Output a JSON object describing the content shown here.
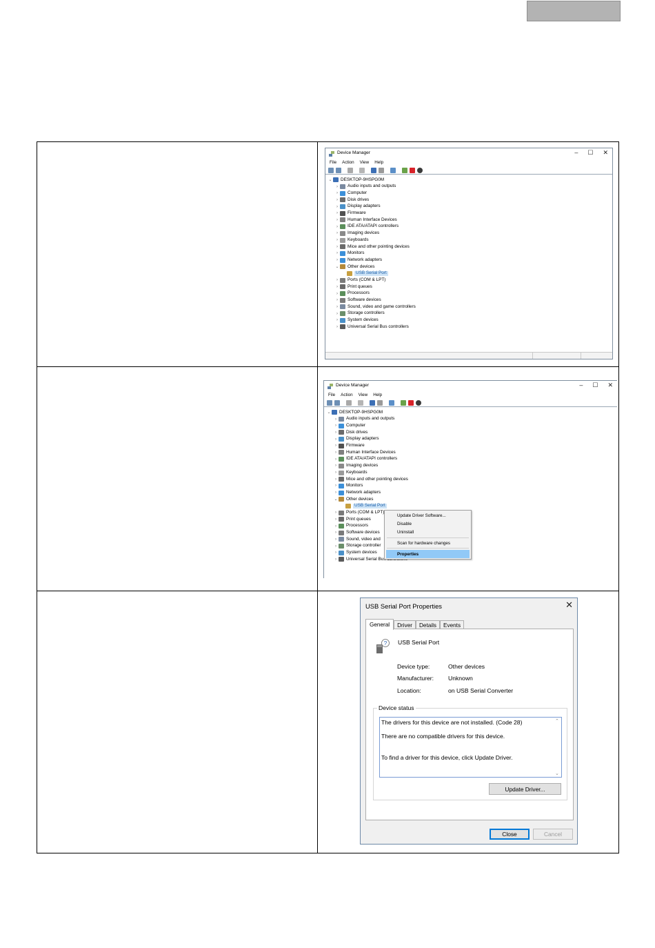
{
  "window1": {
    "title": "Device Manager",
    "menu": [
      "File",
      "Action",
      "View",
      "Help"
    ],
    "root": "DESKTOP-9HSPG0M",
    "categories": [
      {
        "label": "Audio inputs and outputs",
        "color": "#7a8aa0"
      },
      {
        "label": "Computer",
        "color": "#3c8fd8"
      },
      {
        "label": "Disk drives",
        "color": "#6b6b6b"
      },
      {
        "label": "Display adapters",
        "color": "#4a90c8"
      },
      {
        "label": "Firmware",
        "color": "#505050"
      },
      {
        "label": "Human Interface Devices",
        "color": "#7f7f7f"
      },
      {
        "label": "IDE ATA/ATAPI controllers",
        "color": "#5b8f5b"
      },
      {
        "label": "Imaging devices",
        "color": "#8a8a8a"
      },
      {
        "label": "Keyboards",
        "color": "#9a9a9a"
      },
      {
        "label": "Mice and other pointing devices",
        "color": "#6a6a6a"
      },
      {
        "label": "Monitors",
        "color": "#3c8fd8"
      },
      {
        "label": "Network adapters",
        "color": "#3c8fd8"
      },
      {
        "label": "Other devices",
        "color": "#b58a3a",
        "expanded": true
      },
      {
        "label": "USB Serial Port",
        "color": "#c8a040",
        "child": true,
        "selected": true
      },
      {
        "label": "Ports (COM & LPT)",
        "color": "#7a7a7a"
      },
      {
        "label": "Print queues",
        "color": "#6a6a6a"
      },
      {
        "label": "Processors",
        "color": "#5b8f5b"
      },
      {
        "label": "Software devices",
        "color": "#7a7a7a"
      },
      {
        "label": "Sound, video and game controllers",
        "color": "#7a8aa0"
      },
      {
        "label": "Storage controllers",
        "color": "#6b8f6b"
      },
      {
        "label": "System devices",
        "color": "#4a90c8"
      },
      {
        "label": "Universal Serial Bus controllers",
        "color": "#5a5a5a"
      }
    ]
  },
  "window2": {
    "title": "Device Manager",
    "menu": [
      "File",
      "Action",
      "View",
      "Help"
    ],
    "root": "DESKTOP-9HSPG0M",
    "categories": [
      {
        "label": "Audio inputs and outputs",
        "color": "#7a8aa0"
      },
      {
        "label": "Computer",
        "color": "#3c8fd8"
      },
      {
        "label": "Disk drives",
        "color": "#6b6b6b"
      },
      {
        "label": "Display adapters",
        "color": "#4a90c8"
      },
      {
        "label": "Firmware",
        "color": "#505050"
      },
      {
        "label": "Human Interface Devices",
        "color": "#7f7f7f"
      },
      {
        "label": "IDE ATA/ATAPI controllers",
        "color": "#5b8f5b"
      },
      {
        "label": "Imaging devices",
        "color": "#8a8a8a"
      },
      {
        "label": "Keyboards",
        "color": "#9a9a9a"
      },
      {
        "label": "Mice and other pointing devices",
        "color": "#6a6a6a"
      },
      {
        "label": "Monitors",
        "color": "#3c8fd8"
      },
      {
        "label": "Network adapters",
        "color": "#3c8fd8"
      },
      {
        "label": "Other devices",
        "color": "#b58a3a",
        "expanded": true
      },
      {
        "label": "USB Serial Port",
        "color": "#c8a040",
        "child": true,
        "selected": true
      },
      {
        "label": "Ports (COM & LPT)",
        "color": "#7a7a7a"
      },
      {
        "label": "Print queues",
        "color": "#6a6a6a"
      },
      {
        "label": "Processors",
        "color": "#5b8f5b"
      },
      {
        "label": "Software devices",
        "color": "#7a7a7a"
      },
      {
        "label": "Sound, video and",
        "color": "#7a8aa0"
      },
      {
        "label": "Storage controller",
        "color": "#6b8f6b"
      },
      {
        "label": "System devices",
        "color": "#4a90c8"
      },
      {
        "label": "Universal Serial Bus controllers",
        "color": "#5a5a5a"
      }
    ]
  },
  "context_menu": {
    "items": [
      "Update Driver Software...",
      "Disable",
      "Uninstall",
      "Scan for hardware changes",
      "Properties"
    ],
    "highlighted": "Properties"
  },
  "properties": {
    "title": "USB Serial Port Properties",
    "tabs": [
      "General",
      "Driver",
      "Details",
      "Events"
    ],
    "active_tab": "General",
    "device_name": "USB Serial Port",
    "device_type_label": "Device type:",
    "device_type": "Other devices",
    "manufacturer_label": "Manufacturer:",
    "manufacturer": "Unknown",
    "location_label": "Location:",
    "location": "on USB Serial Converter",
    "status_label": "Device status",
    "status_line1": "The drivers for this device are not installed. (Code 28)",
    "status_line2": "There are no compatible drivers for this device.",
    "status_line3": "To find a driver for this device, click Update Driver.",
    "update_button": "Update Driver...",
    "close_button": "Close",
    "cancel_button": "Cancel"
  }
}
